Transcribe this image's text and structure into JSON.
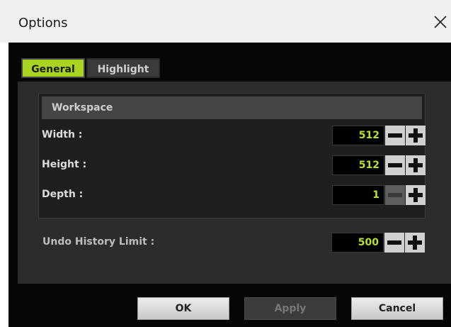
{
  "window": {
    "title": "Options"
  },
  "tabs": [
    {
      "label": "General",
      "active": true
    },
    {
      "label": "Highlight",
      "active": false
    }
  ],
  "workspace": {
    "header": "Workspace",
    "rows": [
      {
        "label": "Width :",
        "value": "512",
        "minus_enabled": true,
        "plus_enabled": true
      },
      {
        "label": "Height :",
        "value": "512",
        "minus_enabled": true,
        "plus_enabled": true
      },
      {
        "label": "Depth :",
        "value": "1",
        "minus_enabled": false,
        "plus_enabled": true
      }
    ]
  },
  "undo": {
    "label": "Undo History Limit :",
    "value": "500"
  },
  "buttons": {
    "ok": "OK",
    "apply": "Apply",
    "cancel": "Cancel"
  },
  "colors": {
    "accent": "#a9d421",
    "value_text": "#b9e228",
    "panel": "#2c2c2c",
    "background": "#060606"
  },
  "icons": {
    "close": "close-icon",
    "minus": "minus-icon",
    "plus": "plus-icon"
  }
}
